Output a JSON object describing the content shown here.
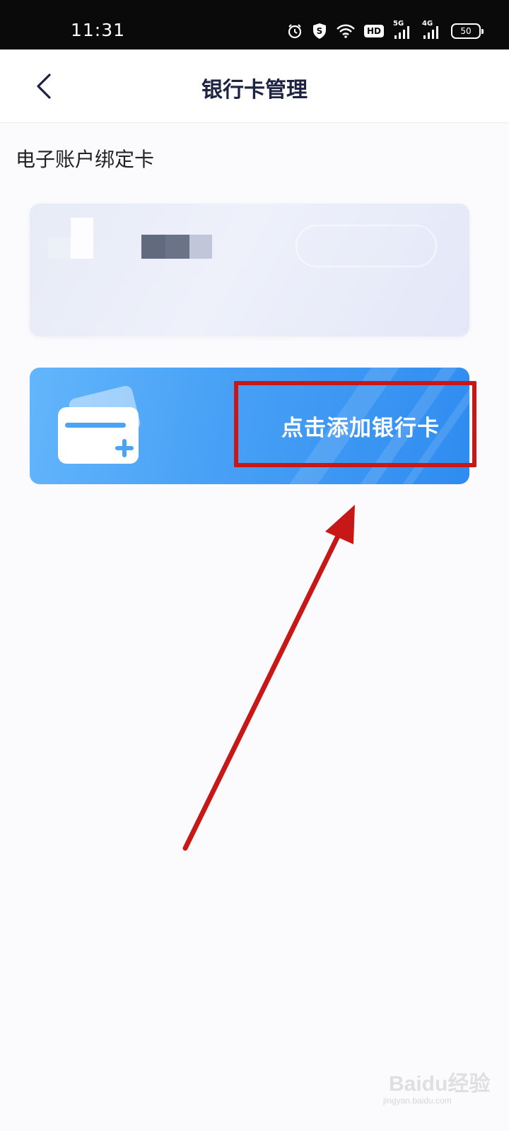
{
  "status_bar": {
    "time": "11:31",
    "hd_label": "HD",
    "signal_1_label": "5G",
    "signal_2_label": "4G",
    "battery_level": "50"
  },
  "nav": {
    "title": "银行卡管理",
    "back_icon": "chevron-left-icon"
  },
  "section": {
    "title": "电子账户绑定卡"
  },
  "bound_card": {
    "redacted": true
  },
  "add_card": {
    "label": "点击添加银行卡",
    "icon": "add-card-icon"
  },
  "watermark": {
    "text": "Baidu经验",
    "sub": "jingyan.baidu.com"
  },
  "colors": {
    "status_bar_bg": "#0a0a0a",
    "title_text": "#1d2340",
    "add_card_start": "#63b6fb",
    "add_card_end": "#2f8cf0",
    "annotation_red": "#c81717"
  }
}
